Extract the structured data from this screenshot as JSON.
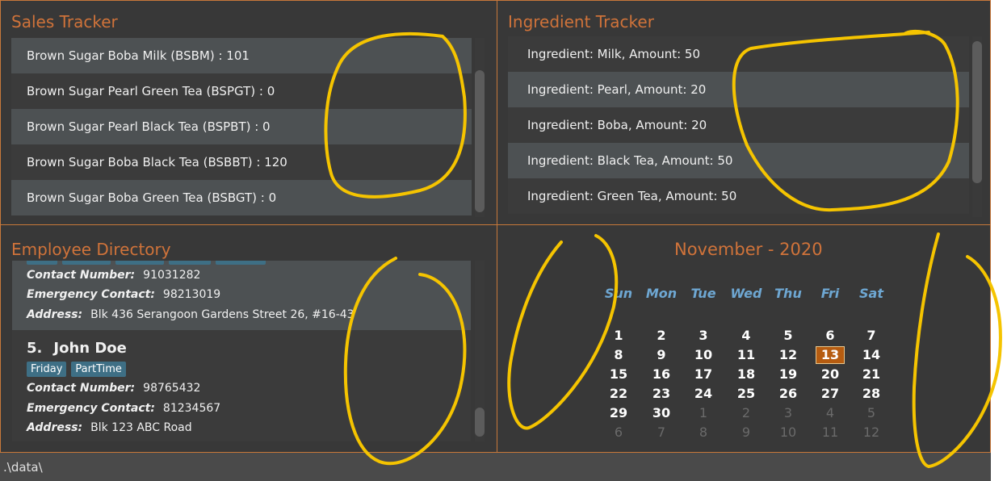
{
  "sales": {
    "title": "Sales Tracker",
    "items": [
      "Brown Sugar Boba Milk (BSBM) : 101",
      "Brown Sugar Pearl Green Tea (BSPGT) : 0",
      "Brown Sugar Pearl Black Tea (BSPBT) : 0",
      "Brown Sugar Boba Black Tea (BSBBT) : 120",
      "Brown Sugar Boba Green Tea (BSBGT) : 0"
    ]
  },
  "ingredients": {
    "title": "Ingredient Tracker",
    "items": [
      "Ingredient: Milk,  Amount: 50",
      "Ingredient: Pearl,  Amount: 20",
      "Ingredient: Boba,  Amount: 20",
      "Ingredient: Black Tea,  Amount: 50",
      "Ingredient: Green Tea,  Amount: 50"
    ]
  },
  "employees": {
    "title": "Employee Directory",
    "partial": {
      "contact_label": "Contact Number:",
      "contact": "91031282",
      "emergency_label": "Emergency Contact:",
      "emergency": "98213019",
      "address_label": "Address:",
      "address": "Blk 436 Serangoon Gardens Street 26, #16-43"
    },
    "card": {
      "index": "5.",
      "name": "John Doe",
      "tags": [
        "Friday",
        "PartTime"
      ],
      "contact_label": "Contact Number:",
      "contact": "98765432",
      "emergency_label": "Emergency Contact:",
      "emergency": "81234567",
      "address_label": "Address:",
      "address": "Blk 123 ABC Road"
    }
  },
  "calendar": {
    "title": "November - 2020",
    "weekdays": [
      "Sun",
      "Mon",
      "Tue",
      "Wed",
      "Thu",
      "Fri",
      "Sat"
    ],
    "weeks": [
      [
        {
          "d": "1"
        },
        {
          "d": "2"
        },
        {
          "d": "3"
        },
        {
          "d": "4"
        },
        {
          "d": "5"
        },
        {
          "d": "6"
        },
        {
          "d": "7"
        }
      ],
      [
        {
          "d": "8"
        },
        {
          "d": "9"
        },
        {
          "d": "10"
        },
        {
          "d": "11"
        },
        {
          "d": "12"
        },
        {
          "d": "13",
          "today": true
        },
        {
          "d": "14"
        }
      ],
      [
        {
          "d": "15"
        },
        {
          "d": "16"
        },
        {
          "d": "17"
        },
        {
          "d": "18"
        },
        {
          "d": "19"
        },
        {
          "d": "20"
        },
        {
          "d": "21"
        }
      ],
      [
        {
          "d": "22"
        },
        {
          "d": "23"
        },
        {
          "d": "24"
        },
        {
          "d": "25"
        },
        {
          "d": "26"
        },
        {
          "d": "27"
        },
        {
          "d": "28"
        }
      ],
      [
        {
          "d": "29"
        },
        {
          "d": "30"
        },
        {
          "d": "1",
          "muted": true
        },
        {
          "d": "2",
          "muted": true
        },
        {
          "d": "3",
          "muted": true
        },
        {
          "d": "4",
          "muted": true
        },
        {
          "d": "5",
          "muted": true
        }
      ],
      [
        {
          "d": "6",
          "muted": true
        },
        {
          "d": "7",
          "muted": true
        },
        {
          "d": "8",
          "muted": true
        },
        {
          "d": "9",
          "muted": true
        },
        {
          "d": "10",
          "muted": true
        },
        {
          "d": "11",
          "muted": true
        },
        {
          "d": "12",
          "muted": true
        }
      ]
    ]
  },
  "status_bar": {
    "path": ".\\data\\"
  },
  "colors": {
    "accent": "#d0733a",
    "annotation": "#f5c400",
    "weekday": "#6ea7d2",
    "today": "#b65c10"
  }
}
